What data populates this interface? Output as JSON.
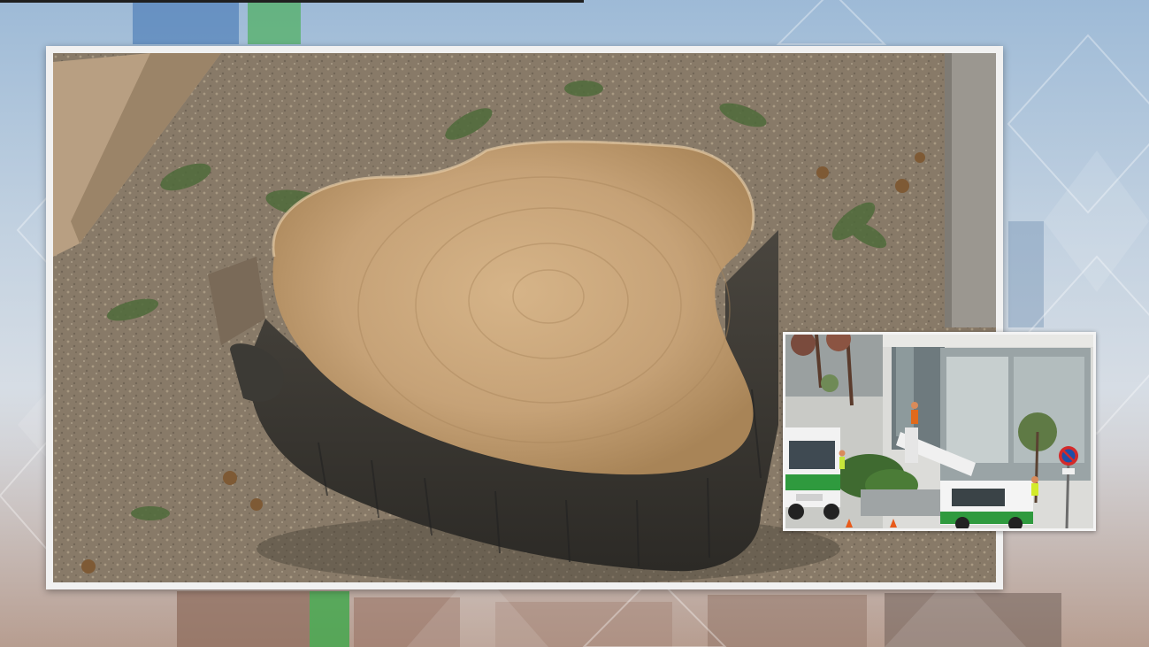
{
  "scene": {
    "main_photo": "tree-stump-closeup",
    "inset_photo": "tree-removal-crew-street"
  },
  "colors": {
    "frame": "#f1f1f1",
    "stump_top": "#c9a47a",
    "bark": "#3e3b36",
    "soil": "#8a7b67",
    "truck_white": "#f2f2f2",
    "truck_green": "#2f9a3e",
    "sign_red": "#d42a2a",
    "sign_blue": "#1f4fa8"
  }
}
